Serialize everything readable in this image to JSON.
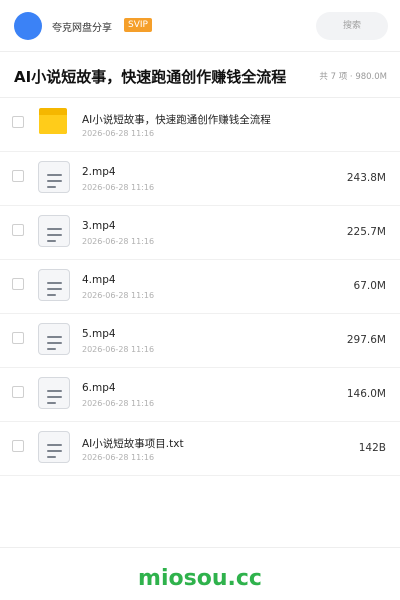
{
  "header": {
    "owner_name": "夸克网盘分享",
    "badge": "SVIP",
    "search_placeholder": "搜索"
  },
  "folder": {
    "title": "AI小说短故事，快速跑通创作赚钱全流程",
    "summary": "共 7 项 · 980.0M"
  },
  "files": [
    {
      "name": "AI小说短故事，快速跑通创作赚钱全流程",
      "date": "2026-06-28 11:16",
      "size": "",
      "type": "folder"
    },
    {
      "name": "2.mp4",
      "date": "2026-06-28 11:16",
      "size": "243.8M",
      "type": "file"
    },
    {
      "name": "3.mp4",
      "date": "2026-06-28 11:16",
      "size": "225.7M",
      "type": "file"
    },
    {
      "name": "4.mp4",
      "date": "2026-06-28 11:16",
      "size": "67.0M",
      "type": "file"
    },
    {
      "name": "5.mp4",
      "date": "2026-06-28 11:16",
      "size": "297.6M",
      "type": "file"
    },
    {
      "name": "6.mp4",
      "date": "2026-06-28 11:16",
      "size": "146.0M",
      "type": "file"
    },
    {
      "name": "AI小说短故事项目.txt",
      "date": "2026-06-28 11:16",
      "size": "142B",
      "type": "file"
    }
  ],
  "footer": {
    "watermark": "miosou.cc"
  },
  "colors": {
    "accent": "#3b82f6",
    "badge": "#f59f2a",
    "folder": "#ffcc1a",
    "watermark": "#2fb24c"
  },
  "icons": {
    "folder": "folder-icon",
    "file": "document-icon"
  }
}
